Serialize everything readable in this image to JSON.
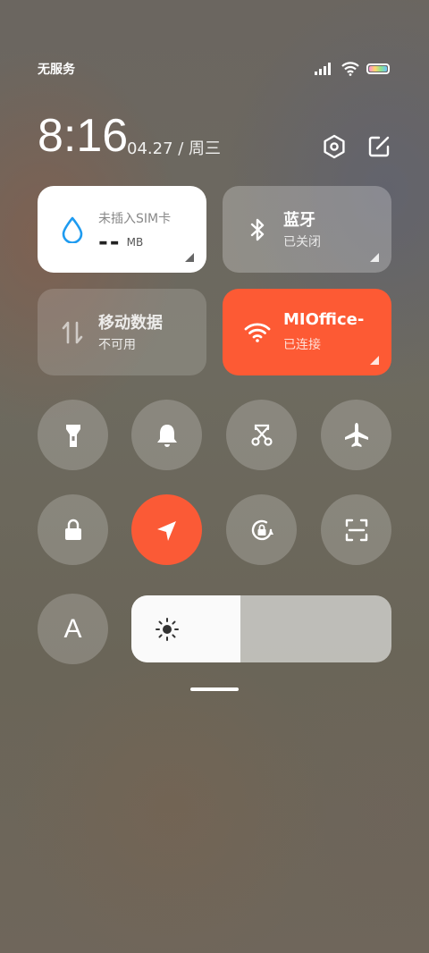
{
  "status_bar": {
    "carrier": "无服务",
    "icons": [
      "signal-icon",
      "wifi-icon",
      "battery-icon"
    ]
  },
  "header": {
    "time": "8:16",
    "date": "04.27 / 周三",
    "icons": [
      "settings-icon",
      "edit-icon"
    ]
  },
  "tiles": {
    "sim": {
      "title": "未插入SIM卡",
      "value": "--",
      "unit": "MB",
      "icon": "water-drop-icon"
    },
    "bluetooth": {
      "title": "蓝牙",
      "status": "已关闭",
      "icon": "bluetooth-icon"
    },
    "mobile_data": {
      "title": "移动数据",
      "status": "不可用",
      "icon": "data-arrows-icon"
    },
    "wifi": {
      "title": "MIOffice-",
      "status": "已连接",
      "icon": "wifi-icon"
    }
  },
  "toggles": [
    {
      "name": "flashlight",
      "icon": "flashlight-icon",
      "active": false
    },
    {
      "name": "silent",
      "icon": "bell-icon",
      "active": false
    },
    {
      "name": "screenshot",
      "icon": "scissors-icon",
      "active": false
    },
    {
      "name": "airplane-mode",
      "icon": "airplane-icon",
      "active": false
    },
    {
      "name": "lock-screen",
      "icon": "lock-icon",
      "active": false
    },
    {
      "name": "location",
      "icon": "location-arrow-icon",
      "active": true
    },
    {
      "name": "rotation-lock",
      "icon": "rotation-lock-icon",
      "active": false
    },
    {
      "name": "scanner",
      "icon": "scan-icon",
      "active": false
    },
    {
      "name": "auto-brightness",
      "icon": "letter-a-icon",
      "label": "A",
      "active": false
    }
  ],
  "brightness": {
    "level_percent": 42,
    "icon": "sun-icon"
  },
  "colors": {
    "accent": "#fb5a36",
    "tile_active": "#ffffff",
    "sim_drop": "#1e9bf0"
  }
}
